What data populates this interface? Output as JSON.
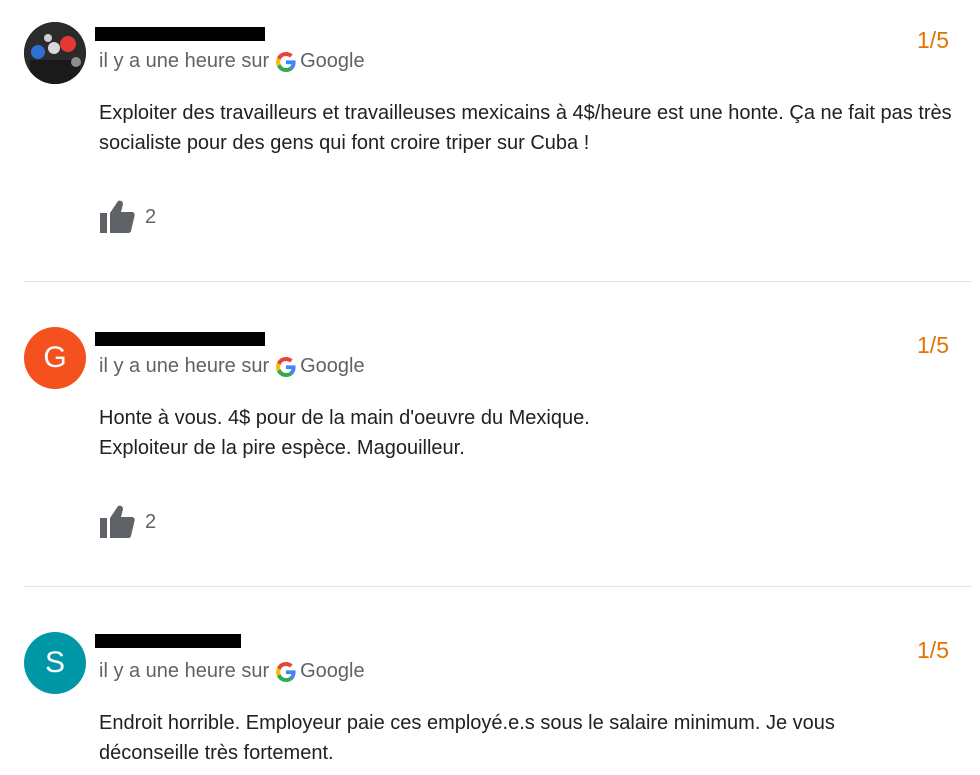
{
  "reviews": [
    {
      "avatar_type": "photo",
      "avatar_letter": "",
      "avatar_color": "#333333",
      "time_source": "il y a une heure sur",
      "source": "Google",
      "rating": "1/5",
      "text": "Exploiter des travailleurs et travailleuses mexicains à 4$/heure est une honte. Ça ne fait pas très socialiste pour des gens qui font croire triper sur Cuba !",
      "likes": "2"
    },
    {
      "avatar_type": "letter",
      "avatar_letter": "G",
      "avatar_color": "#f4511e",
      "time_source": "il y a une heure sur",
      "source": "Google",
      "rating": "1/5",
      "text_line1": "Honte à vous. 4$ pour de la main d'oeuvre du Mexique.",
      "text_line2": "Exploiteur de la pire espèce. Magouilleur.",
      "likes": "2"
    },
    {
      "avatar_type": "letter",
      "avatar_letter": "S",
      "avatar_color": "#0097a7",
      "time_source": "il y a une heure sur",
      "source": "Google",
      "rating": "1/5",
      "text": "Endroit horrible. Employeur paie ces employé.e.s sous le salaire minimum. Je vous déconseille très fortement."
    }
  ],
  "colors": {
    "rating": "#e37400",
    "meta_text": "#5f6368",
    "body_text": "#202124",
    "like_icon": "#5f6368"
  },
  "icons": {
    "like": "thumbs-up-icon",
    "source": "google-g-icon"
  }
}
